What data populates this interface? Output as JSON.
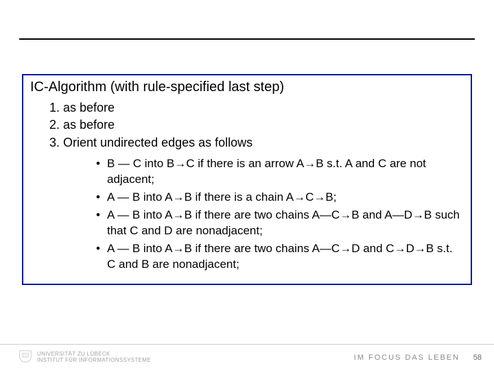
{
  "title": "IC-Algorithm (with rule-specified last step)",
  "steps": {
    "s1": "as before",
    "s2": "as before",
    "s3": "Orient undirected edges as follows"
  },
  "rules": {
    "r1": "B — C  into B→C if there is an arrow A→B s.t. A and C are not adjacent;",
    "r2": "A — B  into A→B  if there is a chain A→C→B;",
    "r3": "A — B  into A→B if there are two chains A—C→B and A—D→B such that C and D are nonadjacent;",
    "r4": "A — B  into A→B if there are two chains A—C→D and C→D→B s.t.  C and B are nonadjacent;"
  },
  "footer": {
    "uni_line1": "UNIVERSITÄT ZU LÜBECK",
    "uni_line2": "INSTITUT FÜR INFORMATIONSSYSTEME",
    "motto": "IM FOCUS DAS LEBEN",
    "page": "58"
  }
}
